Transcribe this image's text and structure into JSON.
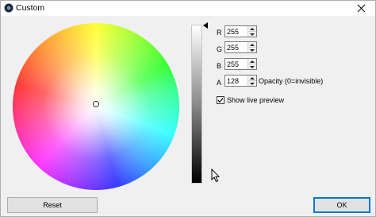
{
  "window": {
    "title": "Custom"
  },
  "icons": {
    "app": "color-picker-app-icon",
    "close": "close-icon",
    "checkmark": "checkmark-icon",
    "cursor": "mouse-pointer-icon"
  },
  "colors": {
    "accent": "#0078d7",
    "dialog_bg": "#f0f0f0",
    "titlebar_bg": "#ffffff"
  },
  "channels": [
    {
      "label": "R",
      "value": "255"
    },
    {
      "label": "G",
      "value": "255"
    },
    {
      "label": "B",
      "value": "255"
    },
    {
      "label": "A",
      "value": "128"
    }
  ],
  "opacity_note": "Opacity (0=invisible)",
  "live_preview": {
    "label": "Show live preview",
    "checked": true
  },
  "buttons": {
    "reset": "Reset",
    "ok": "OK"
  }
}
